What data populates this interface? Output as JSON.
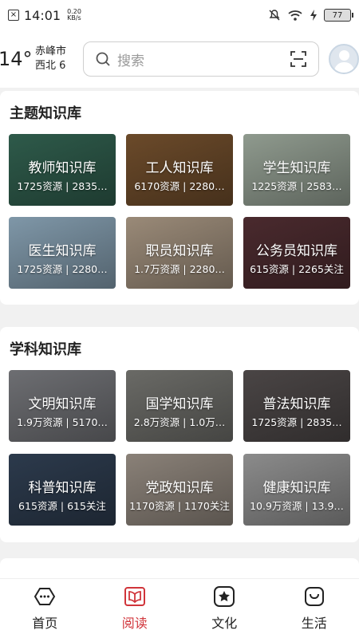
{
  "status": {
    "time": "14:01",
    "speed_value": "0.20",
    "speed_unit": "KB/s",
    "battery": "77"
  },
  "header": {
    "temp": "14°",
    "city": "赤峰市",
    "wind": "西北 6",
    "search_placeholder": "搜索"
  },
  "sections": [
    {
      "title": "主题知识库",
      "cards": [
        {
          "title": "教师知识库",
          "meta": "1725资源 | 2835…",
          "bg": "#2e5a4a"
        },
        {
          "title": "工人知识库",
          "meta": "6170资源 | 2280…",
          "bg": "#6b4a2a"
        },
        {
          "title": "学生知识库",
          "meta": "1225资源 | 2583…",
          "bg": "#8f9a8e"
        },
        {
          "title": "医生知识库",
          "meta": "1725资源 | 2280…",
          "bg": "#7f97a8"
        },
        {
          "title": "职员知识库",
          "meta": "1.7万资源 | 2280…",
          "bg": "#9a8a78"
        },
        {
          "title": "公务员知识库",
          "meta": "615资源 | 2265关注",
          "bg": "#4a2a2e"
        }
      ]
    },
    {
      "title": "学科知识库",
      "cards": [
        {
          "title": "文明知识库",
          "meta": "1.9万资源 | 5170…",
          "bg": "#6d6e72"
        },
        {
          "title": "国学知识库",
          "meta": "2.8万资源 | 1.0万…",
          "bg": "#6a6a66"
        },
        {
          "title": "普法知识库",
          "meta": "1725资源 | 2835…",
          "bg": "#4a4545"
        },
        {
          "title": "科普知识库",
          "meta": "615资源 | 615关注",
          "bg": "#2c3a4c"
        },
        {
          "title": "党政知识库",
          "meta": "1170资源 | 1170关注",
          "bg": "#8a8178"
        },
        {
          "title": "健康知识库",
          "meta": "10.9万资源 | 13.9…",
          "bg": "#8b8b8b"
        }
      ]
    }
  ],
  "nav": [
    {
      "label": "首页",
      "icon": "home-chat-icon",
      "active": false
    },
    {
      "label": "阅读",
      "icon": "book-icon",
      "active": true
    },
    {
      "label": "文化",
      "icon": "star-box-icon",
      "active": false
    },
    {
      "label": "生活",
      "icon": "bag-icon",
      "active": false
    }
  ],
  "colors": {
    "accent": "#d0343a"
  }
}
